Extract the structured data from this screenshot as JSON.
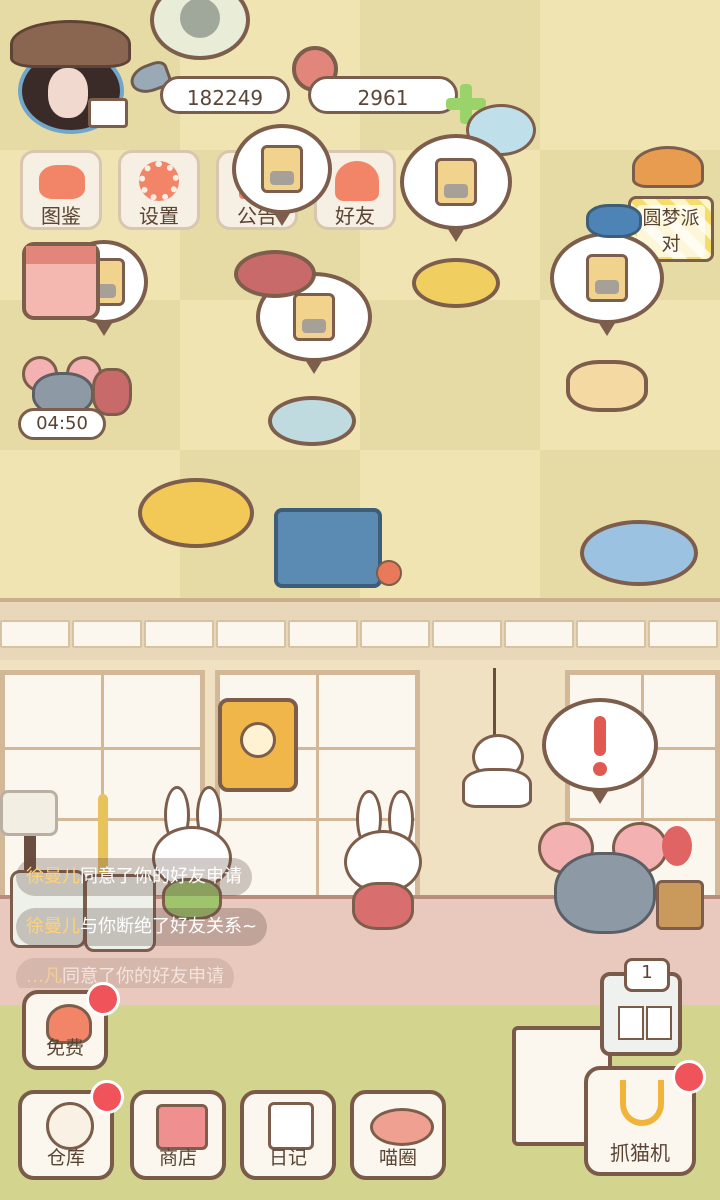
{
  "currency": {
    "coins": "182249",
    "hearts": "2961"
  },
  "menu": [
    {
      "label": "图鉴",
      "icon": "cat-book-icon"
    },
    {
      "label": "设置",
      "icon": "gear-icon"
    },
    {
      "label": "公告",
      "icon": "gift-icon"
    },
    {
      "label": "好友",
      "icon": "friends-icon"
    }
  ],
  "event": {
    "label": "圆梦派对"
  },
  "timer": {
    "value": "04:50"
  },
  "messages": [
    {
      "name": "徐曼儿",
      "text": "同意了你的好友申请"
    },
    {
      "name": "徐曼儿",
      "text": "与你断绝了好友关系~"
    },
    {
      "name": "…凡",
      "text": "同意了你的好友申请"
    }
  ],
  "free": {
    "label": "免费"
  },
  "nav": [
    {
      "label": "仓库",
      "icon": "storage-icon"
    },
    {
      "label": "商店",
      "icon": "shop-icon"
    },
    {
      "label": "日记",
      "icon": "diary-icon"
    },
    {
      "label": "喵圈",
      "icon": "cat-planet-icon"
    }
  ],
  "claw": {
    "label": "抓猫机",
    "count": "1"
  },
  "colors": {
    "floor": "#efe4b2",
    "badge": "#f0545a",
    "outline": "#7a5a48"
  }
}
